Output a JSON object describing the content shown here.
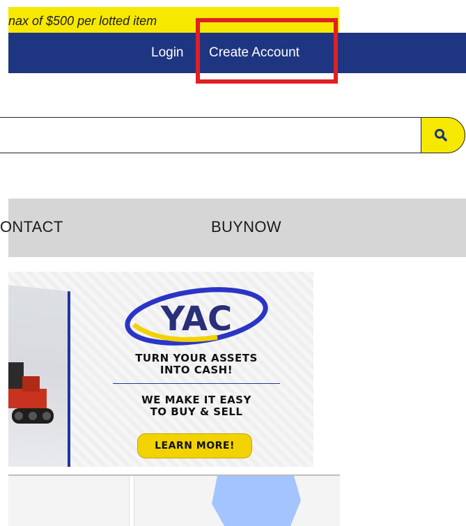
{
  "notice": {
    "text": "nax of $500 per lotted item"
  },
  "topnav": {
    "login_label": "Login",
    "create_account_label": "Create Account"
  },
  "search": {
    "value": "",
    "placeholder": "",
    "icon": "search-icon"
  },
  "menu": {
    "items": [
      {
        "label": "ONTACT"
      },
      {
        "label": "BUYNOW"
      }
    ]
  },
  "banner": {
    "logo_text": "YAC",
    "headline_line1": "TURN YOUR ASSETS",
    "headline_line2": "INTO CASH!",
    "subline_line1": "WE MAKE IT EASY",
    "subline_line2": "TO BUY & SELL",
    "button_label": "LEARN MORE!"
  },
  "colors": {
    "accent_yellow": "#f7e800",
    "nav_blue": "#1e3581",
    "highlight_red": "#e01f26",
    "menu_gray": "#d6d6d6"
  }
}
